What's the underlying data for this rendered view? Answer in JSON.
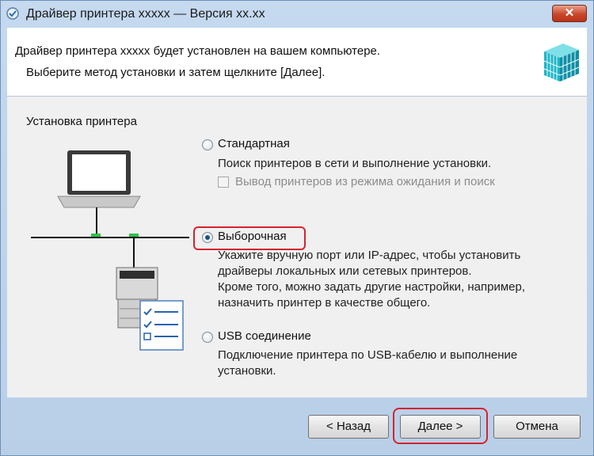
{
  "window": {
    "title": "Драйвер принтера xxxxx — Версия xx.xx",
    "close_label": "✕"
  },
  "header": {
    "line1": "Драйвер принтера xxxxx будет установлен на вашем компьютере.",
    "line2": "Выберите метод установки и затем щелкните [Далее]."
  },
  "install": {
    "group_label": "Установка принтера",
    "options": [
      {
        "label": "Стандартная",
        "selected": false,
        "description": [
          "Поиск принтеров в сети и выполнение установки."
        ],
        "sub_checkbox": {
          "label": "Вывод принтеров из режима ожидания и поиск",
          "checked": false,
          "enabled": false
        }
      },
      {
        "label": "Выборочная",
        "selected": true,
        "description": [
          "Укажите вручную порт или IP-адрес, чтобы установить",
          "драйверы локальных или сетевых принтеров.",
          "Кроме того, можно задать другие настройки, например,",
          "назначить принтер в качестве общего."
        ]
      },
      {
        "label": "USB соединение",
        "selected": false,
        "description": [
          "Подключение принтера по USB-кабелю и выполнение",
          "установки."
        ]
      }
    ]
  },
  "buttons": {
    "back": "< Назад",
    "next": "Далее >",
    "cancel": "Отмена"
  },
  "colors": {
    "highlight": "#d6232e",
    "window_frame": "#c5d9ef",
    "radio_dot": "#1c4f8c"
  }
}
